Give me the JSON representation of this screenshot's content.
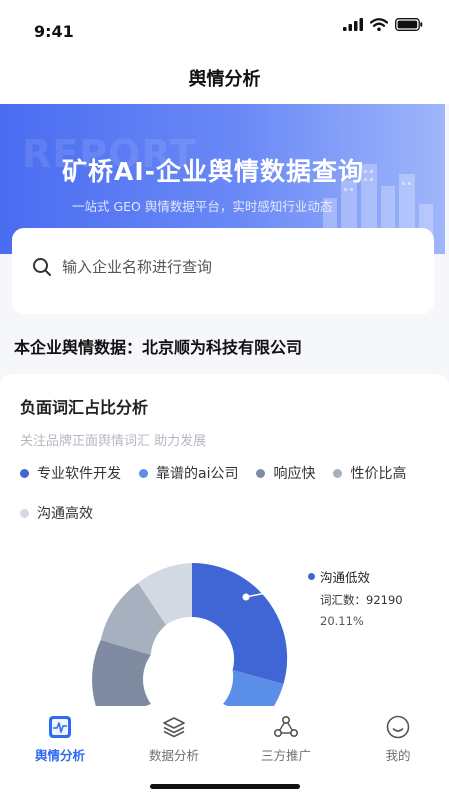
{
  "status_bar": {
    "time": "9:41"
  },
  "header": {
    "title": "舆情分析"
  },
  "banner": {
    "watermark": "REPORT",
    "title": "矿桥AI-企业舆情数据查询",
    "subtitle": "一站式 GEO 舆情数据平台，实时感知行业动态"
  },
  "search": {
    "placeholder": "输入企业名称进行查询"
  },
  "company": {
    "label": "本企业舆情数据：北京顺为科技有限公司"
  },
  "analysis": {
    "title": "负面词汇占比分析",
    "subtitle": "关注品牌正面舆情词汇 助力发展",
    "legend": [
      {
        "label": "专业软件开发",
        "color": "#3f66d4"
      },
      {
        "label": "靠谱的ai公司",
        "color": "#5b8ee8"
      },
      {
        "label": "响应快",
        "color": "#7f8ba0"
      },
      {
        "label": "性价比高",
        "color": "#a7b0bf"
      },
      {
        "label": "沟通高效",
        "color": "#d3d9e3"
      }
    ],
    "tooltip": {
      "name": "沟通低效",
      "count": "词汇数：92190",
      "percent": "20.11%",
      "dot_color": "#3f66d4"
    }
  },
  "tabbar": {
    "items": [
      {
        "label": "舆情分析",
        "active": true
      },
      {
        "label": "数据分析",
        "active": false
      },
      {
        "label": "三方推广",
        "active": false
      },
      {
        "label": "我的",
        "active": false
      }
    ]
  }
}
